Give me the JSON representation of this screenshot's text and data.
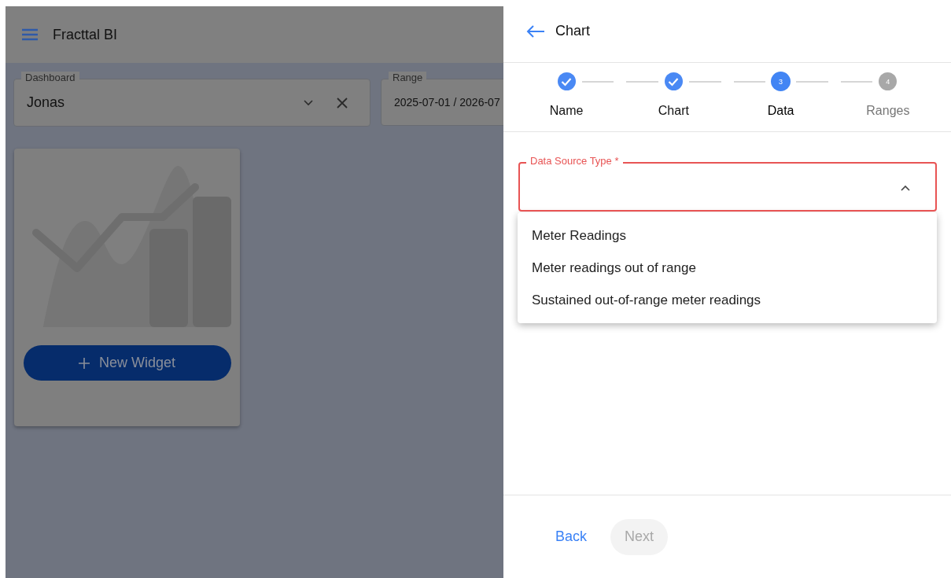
{
  "app_bar": {
    "title": "Fracttal BI"
  },
  "filters": [
    {
      "label": "Dashboard",
      "value": "Jonas",
      "kind": "select"
    },
    {
      "label": "Range",
      "value": "2025-07-01 / 2026-07",
      "kind": "date"
    }
  ],
  "widget_card": {
    "button": "New Widget"
  },
  "panel": {
    "title": "Chart",
    "steps": [
      {
        "label": "Name",
        "completed": true,
        "active": false
      },
      {
        "label": "Chart",
        "completed": true,
        "active": false
      },
      {
        "number": "3",
        "label": "Data",
        "completed": false,
        "active": true
      },
      {
        "number": "4",
        "label": "Ranges",
        "completed": false,
        "active": false
      }
    ],
    "field": {
      "label": "Data Source Type *",
      "error": true,
      "expanded": true,
      "options": [
        {
          "label": "Meter Readings",
          "selected": false
        },
        {
          "label": "Meter readings out of range",
          "selected": false
        },
        {
          "label": "Sustained out-of-range meter readings",
          "selected": false
        }
      ]
    },
    "buttons": [
      {
        "label": "Back",
        "disabled": false,
        "kind": "text"
      },
      {
        "label": "Next",
        "disabled": true,
        "kind": "filled"
      }
    ]
  }
}
